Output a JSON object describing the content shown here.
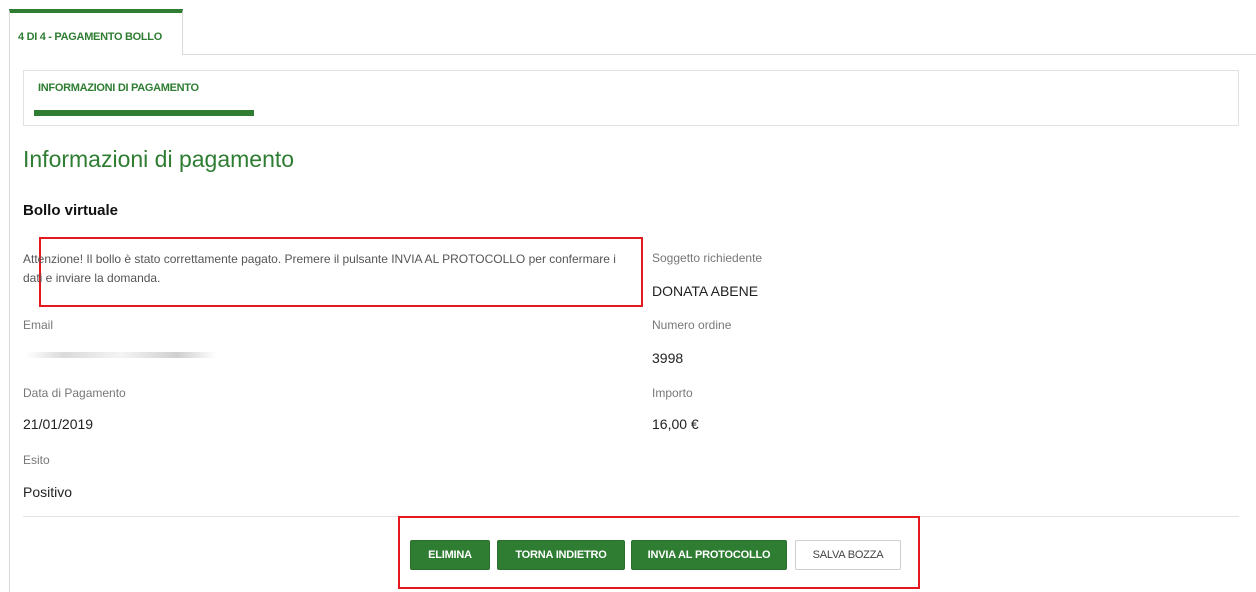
{
  "tabs": {
    "outer_tab_label": "4 DI 4 - PAGAMENTO BOLLO",
    "inner_tab_label": "INFORMAZIONI DI PAGAMENTO"
  },
  "page": {
    "title": "Informazioni di pagamento",
    "subtitle": "Bollo virtuale"
  },
  "notice": {
    "text": "Attenzione! Il bollo è stato correttamente pagato. Premere il pulsante INVIA AL PROTOCOLLO per confermare i dati e inviare la domanda."
  },
  "fields": {
    "soggetto_label": "Soggetto richiedente",
    "soggetto_value": "DONATA ABENE",
    "email_label": "Email",
    "numero_label": "Numero ordine",
    "numero_value": "3998",
    "data_label": "Data di Pagamento",
    "data_value": "21/01/2019",
    "importo_label": "Importo",
    "importo_value": "16,00 €",
    "esito_label": "Esito",
    "esito_value": "Positivo"
  },
  "actions": {
    "elimina": "ELIMINA",
    "torna_indietro": "TORNA INDIETRO",
    "invia_protocollo": "INVIA AL PROTOCOLLO",
    "salva_bozza": "SALVA BOZZA"
  },
  "colors": {
    "primary_green": "#2e7d32",
    "highlight_red": "#e3191d"
  }
}
